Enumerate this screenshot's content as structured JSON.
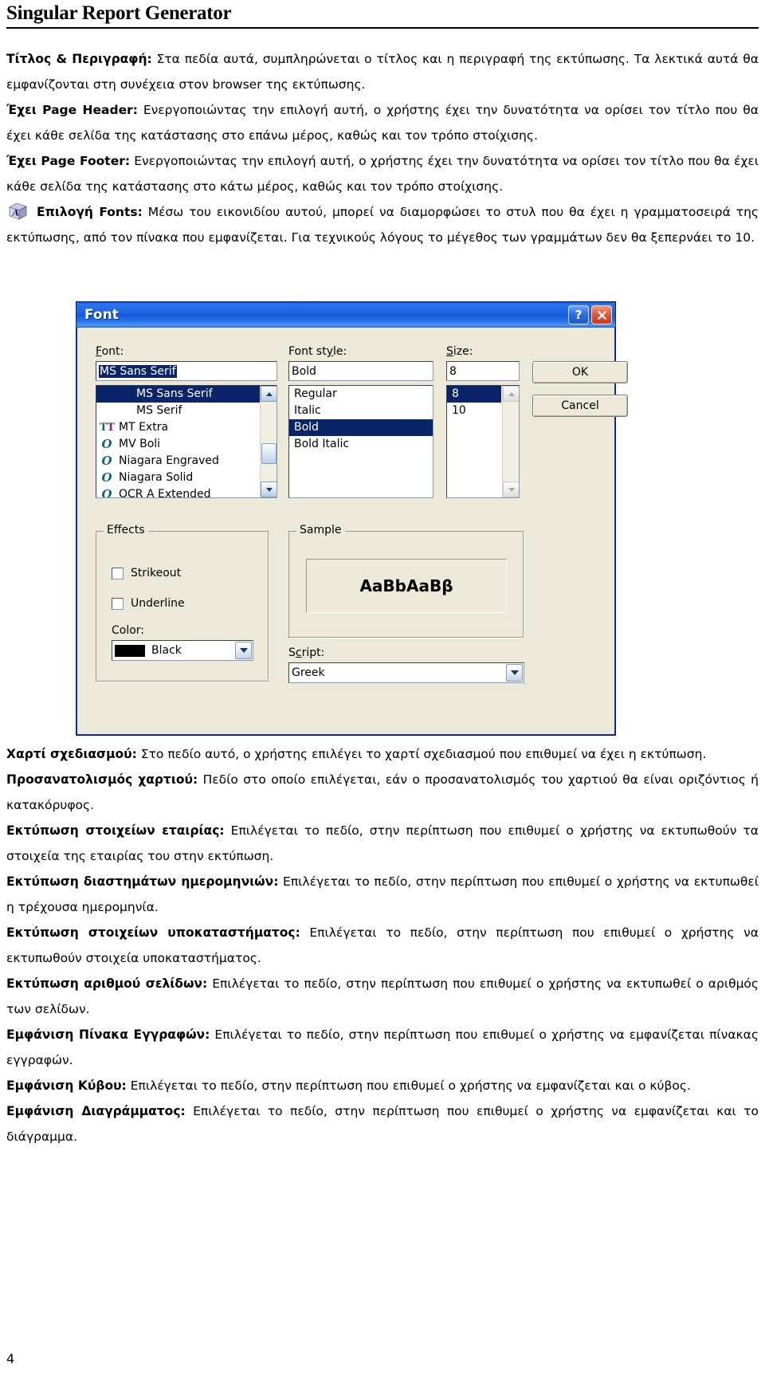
{
  "header": {
    "title": "Singular Report Generator"
  },
  "body_top": [
    {
      "id": "title-description",
      "label": "Τίτλος & Περιγραφή:",
      "text": " Στα πεδία αυτά, συμπληρώνεται ο τίτλος και η περιγραφή της εκτύπωσης. Τα λεκτικά αυτά θα εμφανίζονται στη συνέχεια στον browser της εκτύπωσης."
    },
    {
      "id": "has-page-header",
      "label": "Έχει Page Header:",
      "text": " Ενεργοποιώντας την επιλογή αυτή, ο χρήστης έχει την δυνατότητα να ορίσει τον τίτλο που θα έχει κάθε σελίδα της κατάστασης στο επάνω μέρος, καθώς και τον τρόπο στοίχισης."
    },
    {
      "id": "has-page-footer",
      "label": "Έχει Page Footer:",
      "text": " Ενεργοποιώντας την επιλογή αυτή, ο χρήστης έχει την δυνατότητα να ορίσει τον τίτλο που θα έχει κάθε σελίδα της κατάστασης στο κάτω μέρος, καθώς και τον τρόπο στοίχισης."
    },
    {
      "id": "fonts-selection",
      "icon": "font-style-icon",
      "label": "Επιλογή Fonts:",
      "text": " Μέσω του εικονιδίου αυτού, μπορεί να διαμορφώσει το στυλ που θα έχει η γραμματοσειρά της εκτύπωσης, από τον πίνακα που εμφανίζεται. Για τεχνικούς λόγους το μέγεθος των γραμμάτων δεν θα ξεπερνάει το 10."
    }
  ],
  "dialog": {
    "title": "Font",
    "help_button": "?",
    "close_button": "✕",
    "labels": {
      "font": "Font:",
      "font_style": "Font style:",
      "size": "Size:",
      "effects": "Effects",
      "sample": "Sample",
      "color": "Color:",
      "script": "Script:"
    },
    "font": {
      "value": "MS Sans Serif",
      "items": [
        {
          "name": "MS Sans Serif",
          "glyph": "",
          "selected": true
        },
        {
          "name": "MS Serif",
          "glyph": "",
          "selected": false
        },
        {
          "name": "MT Extra",
          "glyph": "TT",
          "selected": false
        },
        {
          "name": "MV Boli",
          "glyph": "O",
          "selected": false
        },
        {
          "name": "Niagara Engraved",
          "glyph": "O",
          "selected": false
        },
        {
          "name": "Niagara Solid",
          "glyph": "O",
          "selected": false
        },
        {
          "name": "OCR A Extended",
          "glyph": "O",
          "selected": false
        }
      ]
    },
    "font_style": {
      "value": "Bold",
      "items": [
        {
          "name": "Regular",
          "selected": false
        },
        {
          "name": "Italic",
          "selected": false
        },
        {
          "name": "Bold",
          "selected": true
        },
        {
          "name": "Bold Italic",
          "selected": false
        }
      ]
    },
    "size": {
      "value": "8",
      "items": [
        {
          "name": "8",
          "selected": true
        },
        {
          "name": "10",
          "selected": false
        }
      ]
    },
    "buttons": {
      "ok": "OK",
      "cancel": "Cancel"
    },
    "effects": {
      "strikeout": {
        "label": "Strikeout",
        "checked": false
      },
      "underline": {
        "label": "Underline",
        "checked": false
      }
    },
    "color": {
      "value": "Black",
      "swatch": "#000000"
    },
    "script": {
      "value": "Greek"
    },
    "sample": {
      "text": "AaBbAaBβ"
    },
    "colors": {
      "titlebar_blue": "#1659dd",
      "face": "#ece9d8",
      "selection": "#0a246a"
    }
  },
  "body_bottom": [
    {
      "id": "paper-design",
      "label": "Χαρτί σχεδιασμού:",
      "text": " Στο πεδίο αυτό, ο χρήστης επιλέγει το χαρτί σχεδιασμού που επιθυμεί να έχει η εκτύπωση."
    },
    {
      "id": "paper-orientation",
      "label": "Προσανατολισμός χαρτιού:",
      "text": " Πεδίο στο οποίο επιλέγεται, εάν ο προσανατολισμός του χαρτιού θα είναι οριζόντιος ή κατακόρυφος."
    },
    {
      "id": "print-company-data",
      "label": "Εκτύπωση στοιχείων εταιρίας:",
      "text": " Επιλέγεται το πεδίο, στην περίπτωση που επιθυμεί ο χρήστης να εκτυπωθούν τα στοιχεία της εταιρίας του στην εκτύπωση."
    },
    {
      "id": "print-date-ranges",
      "label": "Εκτύπωση διαστημάτων ημερομηνιών:",
      "text": " Επιλέγεται το πεδίο, στην περίπτωση που επιθυμεί ο χρήστης να εκτυπωθεί η τρέχουσα ημερομηνία."
    },
    {
      "id": "print-branch-data",
      "label": "Εκτύπωση στοιχείων υποκαταστήματος:",
      "text": " Επιλέγεται το πεδίο, στην περίπτωση που επιθυμεί ο χρήστης να εκτυπωθούν στοιχεία υποκαταστήματος."
    },
    {
      "id": "print-page-number",
      "label": "Εκτύπωση αριθμού σελίδων:",
      "text": " Επιλέγεται το πεδίο, στην περίπτωση που επιθυμεί ο χρήστης να εκτυπωθεί ο αριθμός των σελίδων."
    },
    {
      "id": "show-records-table",
      "label": "Εμφάνιση Πίνακα Εγγραφών:",
      "text": " Επιλέγεται το πεδίο, στην περίπτωση που επιθυμεί ο χρήστης να εμφανίζεται πίνακας εγγραφών."
    },
    {
      "id": "show-cube",
      "label": "Εμφάνιση Κύβου:",
      "text": " Επιλέγεται το πεδίο, στην περίπτωση που επιθυμεί ο χρήστης να εμφανίζεται και ο κύβος."
    },
    {
      "id": "show-chart",
      "label": "Εμφάνιση Διαγράμματος:",
      "text": " Επιλέγεται το πεδίο, στην περίπτωση που επιθυμεί ο χρήστης να εμφανίζεται και το διάγραμμα."
    }
  ],
  "footer": {
    "page_number": "4"
  }
}
